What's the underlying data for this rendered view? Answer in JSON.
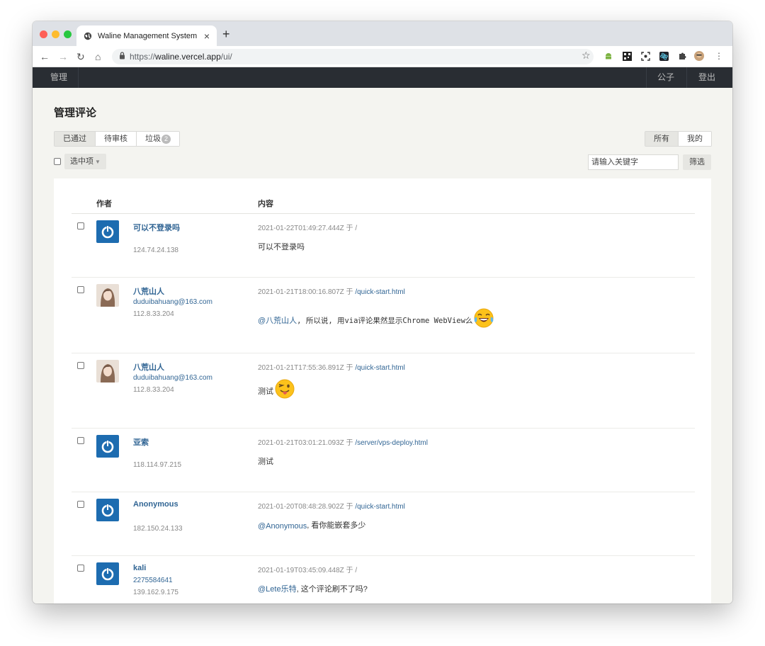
{
  "browser": {
    "tab_title": "Waline Management System",
    "new_tab_symbol": "+",
    "url_scheme": "https://",
    "url_host": "waline.vercel.app",
    "url_path": "/ui/"
  },
  "app_nav": {
    "manage_label": "管理",
    "user_label": "公子",
    "logout_label": "登出"
  },
  "page": {
    "title": "管理评论",
    "status_tabs": [
      {
        "label": "已通过",
        "active": true
      },
      {
        "label": "待审核",
        "active": false
      },
      {
        "label": "垃圾",
        "active": false,
        "badge": "2"
      }
    ],
    "scope_tabs": [
      {
        "label": "所有",
        "active": true
      },
      {
        "label": "我的",
        "active": false
      }
    ],
    "bulk_label": "选中项",
    "search_placeholder": "请输入关键字",
    "filter_label": "筛选"
  },
  "table": {
    "col_author": "作者",
    "col_content": "内容",
    "rows": [
      {
        "name": "可以不登录吗",
        "email": "",
        "ip": "124.74.24.138",
        "time": "2021-01-22T01:49:27.444Z 于 ",
        "path": "/",
        "mention": "",
        "comment": "可以不登录吗",
        "avatar": "default",
        "emoji": ""
      },
      {
        "name": "八荒山人",
        "email": "duduibahuang@163.com",
        "ip": "112.8.33.204",
        "time": "2021-01-21T18:00:16.807Z 于 ",
        "path": "/quick-start.html",
        "mention": "@八荒山人",
        "comment": " , 所以说, 用via评论果然显示Chrome WebView么",
        "avatar": "photo",
        "emoji": "joy"
      },
      {
        "name": "八荒山人",
        "email": "duduibahuang@163.com",
        "ip": "112.8.33.204",
        "time": "2021-01-21T17:55:36.891Z 于 ",
        "path": "/quick-start.html",
        "mention": "",
        "comment": "测试",
        "avatar": "photo",
        "emoji": "wink"
      },
      {
        "name": "亚索",
        "email": "",
        "ip": "118.114.97.215",
        "time": "2021-01-21T03:01:21.093Z 于 ",
        "path": "/server/vps-deploy.html",
        "mention": "",
        "comment": "测试",
        "avatar": "default",
        "emoji": ""
      },
      {
        "name": "Anonymous",
        "email": "",
        "ip": "182.150.24.133",
        "time": "2021-01-20T08:48:28.902Z 于 ",
        "path": "/quick-start.html",
        "mention": "@Anonymous",
        "comment": " , 看你能嵌套多少",
        "avatar": "default",
        "emoji": ""
      },
      {
        "name": "kali",
        "email": "2275584641",
        "ip": "139.162.9.175",
        "time": "2021-01-19T03:45:09.448Z 于 ",
        "path": "/",
        "mention": "@Lete乐特",
        "comment": " , 这个评论刷不了吗?",
        "avatar": "default",
        "emoji": ""
      }
    ]
  },
  "colors": {
    "nav_bg": "#292d33",
    "link": "#316594",
    "avatar_blue": "#1d6cb0",
    "page_bg": "#f4f4f0"
  }
}
